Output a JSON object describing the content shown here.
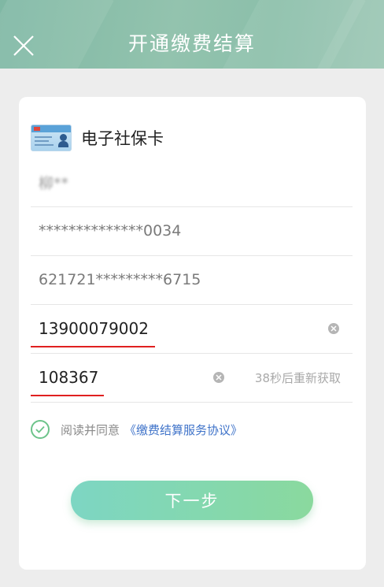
{
  "header": {
    "title": "开通缴费结算",
    "close_icon": "close-icon"
  },
  "card": {
    "name": "电子社保卡",
    "icon": "social-security-card-icon",
    "holder_name": "柳**",
    "id_number": "**************0034",
    "bank_card": "621721*********6715",
    "phone_value": "13900079002",
    "sms_code": "108367",
    "resend_text": "38秒后重新获取"
  },
  "agreement": {
    "prefix": "阅读并同意",
    "link_text": "《缴费结算服务协议》",
    "checked": true
  },
  "actions": {
    "next_label": "下一步"
  },
  "colors": {
    "header": "#8fc2ad",
    "accent_link": "#3f73c9",
    "underline_red": "#e02020",
    "button_gradient_start": "#7dd6c3",
    "button_gradient_end": "#8ad99e",
    "check_green": "#6cc38a"
  }
}
